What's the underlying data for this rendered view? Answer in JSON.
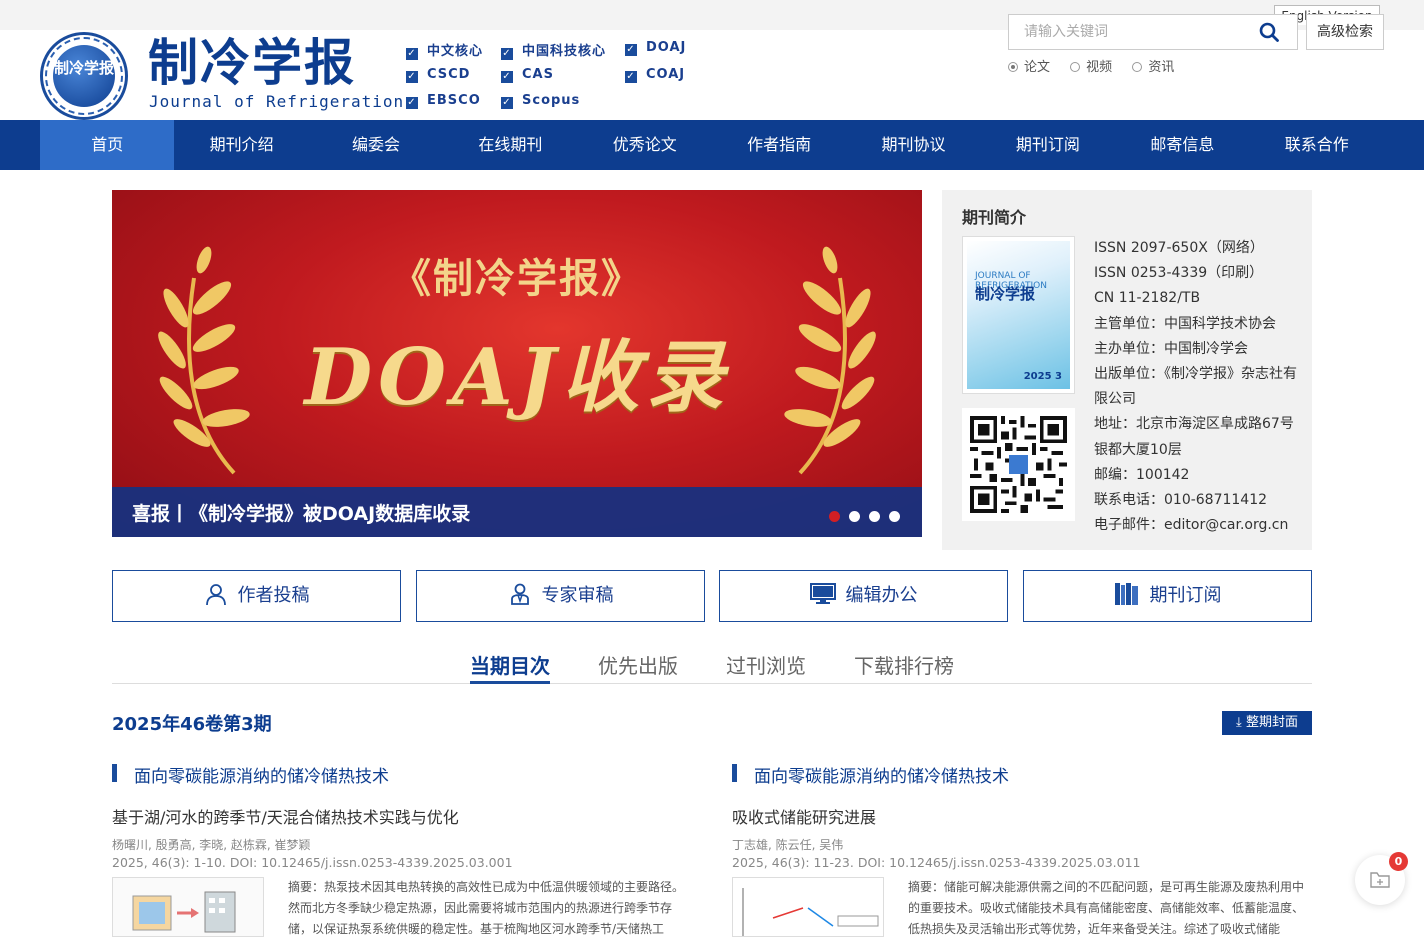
{
  "header": {
    "english_link": "English Version",
    "title_cn": "制冷学报",
    "title_en": "Journal of Refrigeration",
    "logo_text": "制冷学报",
    "index_badges": [
      "中文核心",
      "中国科技核心",
      "DOAJ",
      "CSCD",
      "CAS",
      "COAJ",
      "EBSCO",
      "Scopus"
    ],
    "search": {
      "placeholder": "请输入关键词",
      "advanced_label": "高级检索",
      "options": [
        "论文",
        "视频",
        "资讯"
      ],
      "selected": "论文"
    }
  },
  "nav": {
    "items": [
      "首页",
      "期刊介绍",
      "编委会",
      "在线期刊",
      "优秀论文",
      "作者指南",
      "期刊协议",
      "期刊订阅",
      "邮寄信息",
      "联系合作"
    ],
    "active": "首页"
  },
  "banner": {
    "line1": "《制冷学报》",
    "line2": "DOAJ收录",
    "caption": "喜报丨《制冷学报》被DOAJ数据库收录",
    "slide_count": 4,
    "active_slide": 1
  },
  "intro": {
    "heading": "期刊简介",
    "cover_en": "JOURNAL OF REFRIGERATION",
    "cover_cn": "制冷学报",
    "cover_issue": "2025 3",
    "lines": [
      "ISSN 2097-650X（网络）",
      "ISSN 0253-4339（印刷）",
      "CN 11-2182/TB",
      "主管单位：中国科学技术协会",
      "主办单位：中国制冷学会",
      "出版单位：《制冷学报》杂志社有限公司",
      "地址：北京市海淀区阜成路67号银都大厦10层",
      "邮编：100142",
      "联系电话：010-68711412",
      "电子邮件：editor@car.org.cn"
    ]
  },
  "quick_links": {
    "author": "作者投稿",
    "reviewer": "专家审稿",
    "editor": "编辑办公",
    "subscribe": "期刊订阅"
  },
  "tabs": {
    "items": [
      "当期目次",
      "优先出版",
      "过刊浏览",
      "下载排行榜"
    ],
    "active": "当期目次"
  },
  "issue": {
    "title": "2025年46卷第3期",
    "cover_button": "整期封面"
  },
  "articles": [
    {
      "section": "面向零碳能源消纳的储冷储热技术",
      "title": "基于湖/河水的跨季节/天混合储热技术实践与优化",
      "authors": "杨曙川, 殷勇高, 李晓, 赵栋霖, 崔梦颖",
      "meta": "2025, 46(3): 1-10. DOI: 10.12465/j.issn.0253-4339.2025.03.001",
      "abstract": "摘要：热泵技术因其电热转换的高效性已成为中低温供暖领域的主要路径。然而北方冬季缺少稳定热源，因此需要将城市范围内的热源进行跨季节存储，以保证热泵系统供暖的稳定性。基于梳陶地区河水跨季节/天储热工"
    },
    {
      "section": "面向零碳能源消纳的储冷储热技术",
      "title": "吸收式储能研究进展",
      "authors": "丁志雄, 陈云任, 吴伟",
      "meta": "2025, 46(3): 11-23. DOI: 10.12465/j.issn.0253-4339.2025.03.011",
      "abstract": "摘要：储能可解决能源供需之间的不匹配问题，是可再生能源及废热利用中的重要技术。吸收式储能技术具有高储能密度、高储能效率、低蓄能温度、低热损失及灵活输出形式等优势，近年来备受关注。综述了吸收式储能"
    }
  ],
  "floating": {
    "badge_count": "0"
  },
  "colors": {
    "primary": "#0d3d8f",
    "accent": "#2e6cc8",
    "banner_red": "#c01a1f",
    "gold": "#f6d98c"
  }
}
